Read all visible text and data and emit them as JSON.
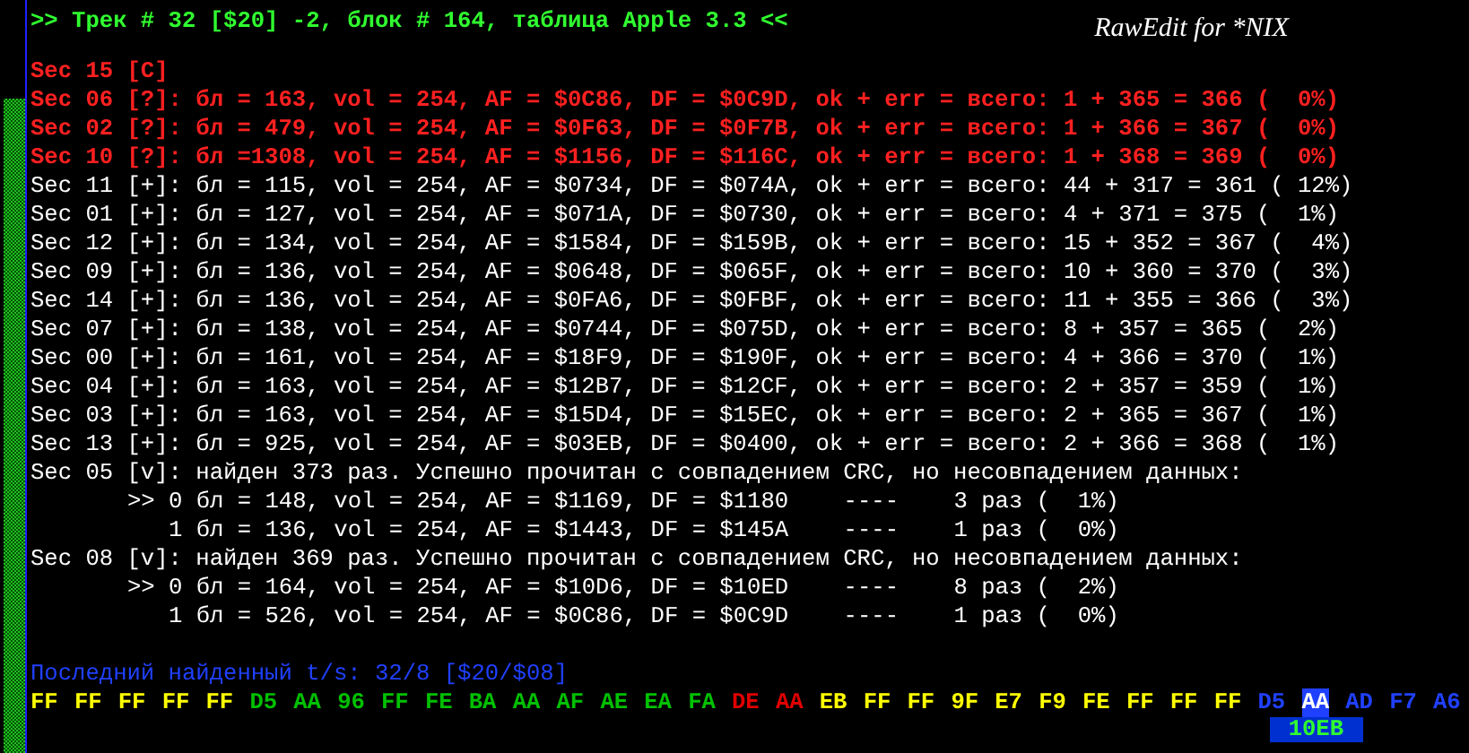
{
  "header": {
    "title": ">> Трек # 32 [$20] -2, блок # 164, таблица Apple 3.3 <<",
    "app_name": "RawEdit for *NIX"
  },
  "sectors": [
    {
      "text": "Sec 15 [C]",
      "color": "#ff2020"
    },
    {
      "text": "Sec 06 [?]: бл = 163, vol = 254, AF = $0C86, DF = $0C9D, ok + err = всего: 1 + 365 = 366 (  0%)",
      "color": "#ff2020"
    },
    {
      "text": "Sec 02 [?]: бл = 479, vol = 254, AF = $0F63, DF = $0F7B, ok + err = всего: 1 + 366 = 367 (  0%)",
      "color": "#ff2020"
    },
    {
      "text": "Sec 10 [?]: бл =1308, vol = 254, AF = $1156, DF = $116C, ok + err = всего: 1 + 368 = 369 (  0%)",
      "color": "#ff2020"
    },
    {
      "text": "Sec 11 [+]: бл = 115, vol = 254, AF = $0734, DF = $074A, ok + err = всего: 44 + 317 = 361 ( 12%)",
      "color": "#ffffff"
    },
    {
      "text": "Sec 01 [+]: бл = 127, vol = 254, AF = $071A, DF = $0730, ok + err = всего: 4 + 371 = 375 (  1%)",
      "color": "#ffffff"
    },
    {
      "text": "Sec 12 [+]: бл = 134, vol = 254, AF = $1584, DF = $159B, ok + err = всего: 15 + 352 = 367 (  4%)",
      "color": "#ffffff"
    },
    {
      "text": "Sec 09 [+]: бл = 136, vol = 254, AF = $0648, DF = $065F, ok + err = всего: 10 + 360 = 370 (  3%)",
      "color": "#ffffff"
    },
    {
      "text": "Sec 14 [+]: бл = 136, vol = 254, AF = $0FA6, DF = $0FBF, ok + err = всего: 11 + 355 = 366 (  3%)",
      "color": "#ffffff"
    },
    {
      "text": "Sec 07 [+]: бл = 138, vol = 254, AF = $0744, DF = $075D, ok + err = всего: 8 + 357 = 365 (  2%)",
      "color": "#ffffff"
    },
    {
      "text": "Sec 00 [+]: бл = 161, vol = 254, AF = $18F9, DF = $190F, ok + err = всего: 4 + 366 = 370 (  1%)",
      "color": "#ffffff"
    },
    {
      "text": "Sec 04 [+]: бл = 163, vol = 254, AF = $12B7, DF = $12CF, ok + err = всего: 2 + 357 = 359 (  1%)",
      "color": "#ffffff"
    },
    {
      "text": "Sec 03 [+]: бл = 163, vol = 254, AF = $15D4, DF = $15EC, ok + err = всего: 2 + 365 = 367 (  1%)",
      "color": "#ffffff"
    },
    {
      "text": "Sec 13 [+]: бл = 925, vol = 254, AF = $03EB, DF = $0400, ok + err = всего: 2 + 366 = 368 (  1%)",
      "color": "#ffffff"
    },
    {
      "text": "Sec 05 [v]: найден 373 раз. Успешно прочитан с совпадением CRC, но несовпадением данных:",
      "color": "#ffffff",
      "children": [
        {
          "marker": ">>",
          "text": "0 бл = 148, vol = 254, AF = $1169, DF = $1180    ----    3 раз (  1%)"
        },
        {
          "text": "1 бл = 136, vol = 254, AF = $1443, DF = $145A    ----    1 раз (  0%)"
        }
      ]
    },
    {
      "text": "Sec 08 [v]: найден 369 раз. Успешно прочитан с совпадением CRC, но несовпадением данных:",
      "color": "#ffffff",
      "children": [
        {
          "marker": ">>",
          "text": "0 бл = 164, vol = 254, AF = $10D6, DF = $10ED    ----    8 раз (  2%)"
        },
        {
          "text": "1 бл = 526, vol = 254, AF = $0C86, DF = $0C9D    ----    1 раз (  0%)"
        }
      ]
    }
  ],
  "status": "Последний найденный t/s: 32/8 [$20/$08]",
  "bytes": [
    {
      "text": "FF",
      "color": "#ffff00",
      "selected": false
    },
    {
      "text": "FF",
      "color": "#ffff00",
      "selected": false
    },
    {
      "text": "FF",
      "color": "#ffff00",
      "selected": false
    },
    {
      "text": "FF",
      "color": "#ffff00",
      "selected": false
    },
    {
      "text": "FF",
      "color": "#ffff00",
      "selected": false
    },
    {
      "text": "D5",
      "color": "#00c000",
      "selected": false
    },
    {
      "text": "AA",
      "color": "#00c000",
      "selected": false
    },
    {
      "text": "96",
      "color": "#00c000",
      "selected": false
    },
    {
      "text": "FF",
      "color": "#00c000",
      "selected": false
    },
    {
      "text": "FE",
      "color": "#00c000",
      "selected": false
    },
    {
      "text": "BA",
      "color": "#00c000",
      "selected": false
    },
    {
      "text": "AA",
      "color": "#00c000",
      "selected": false
    },
    {
      "text": "AF",
      "color": "#00c000",
      "selected": false
    },
    {
      "text": "AE",
      "color": "#00c000",
      "selected": false
    },
    {
      "text": "EA",
      "color": "#00c000",
      "selected": false
    },
    {
      "text": "FA",
      "color": "#00c000",
      "selected": false
    },
    {
      "text": "DE",
      "color": "#e00000",
      "selected": false
    },
    {
      "text": "AA",
      "color": "#e00000",
      "selected": false
    },
    {
      "text": "EB",
      "color": "#ffff00",
      "selected": false
    },
    {
      "text": "FF",
      "color": "#ffff00",
      "selected": false
    },
    {
      "text": "FF",
      "color": "#ffff00",
      "selected": false
    },
    {
      "text": "9F",
      "color": "#ffff00",
      "selected": false
    },
    {
      "text": "E7",
      "color": "#ffff00",
      "selected": false
    },
    {
      "text": "F9",
      "color": "#ffff00",
      "selected": false
    },
    {
      "text": "FE",
      "color": "#ffff00",
      "selected": false
    },
    {
      "text": "FF",
      "color": "#ffff00",
      "selected": false
    },
    {
      "text": "FF",
      "color": "#ffff00",
      "selected": false
    },
    {
      "text": "FF",
      "color": "#ffff00",
      "selected": false
    },
    {
      "text": "D5",
      "color": "#2040ff",
      "selected": false
    },
    {
      "text": "AA",
      "color": "#2040ff",
      "selected": true,
      "offset": "10EB"
    },
    {
      "text": "AD",
      "color": "#2040ff",
      "selected": false
    },
    {
      "text": "F7",
      "color": "#2040ff",
      "selected": false
    },
    {
      "text": "A6",
      "color": "#2040ff",
      "selected": false
    }
  ]
}
